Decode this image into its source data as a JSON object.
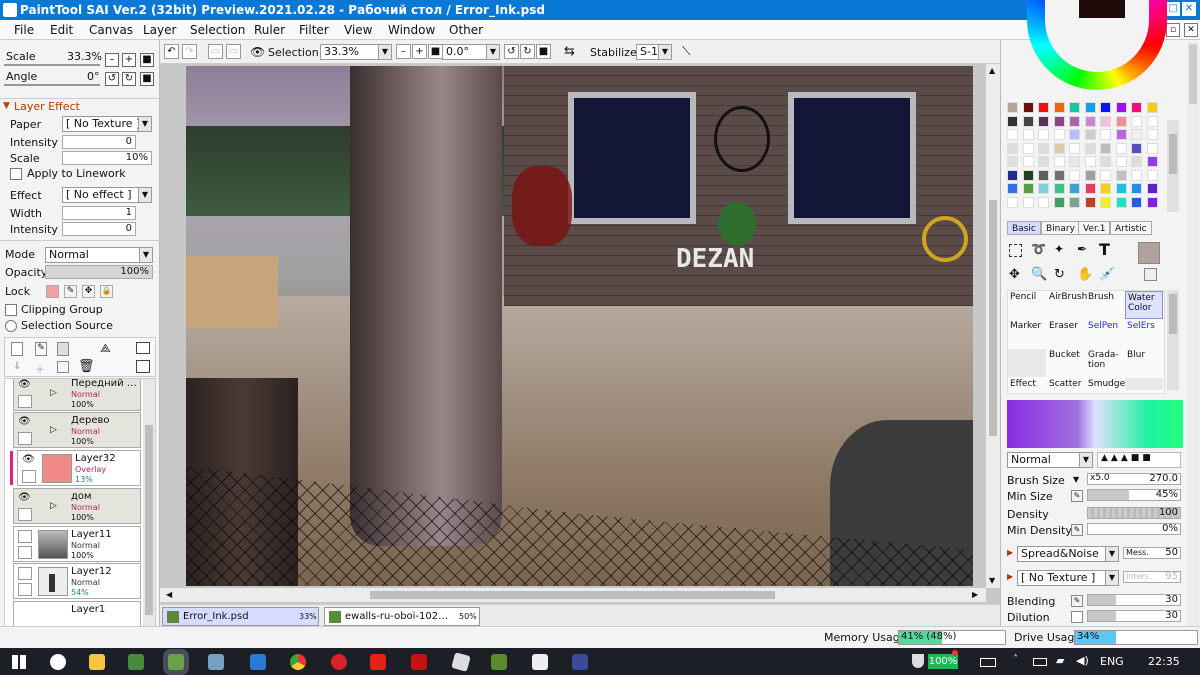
{
  "app": {
    "title": "PaintTool SAI Ver.2 (32bit) Preview.2021.02.28 - Рабочий стол / Error_Ink.psd",
    "minimize": "–",
    "maximize": "□",
    "close": "✕"
  },
  "menu": [
    "File",
    "Edit",
    "Canvas",
    "Layer",
    "Selection",
    "Ruler",
    "Filter",
    "View",
    "Window",
    "Other"
  ],
  "toolbar": {
    "selection_label": "Selection",
    "zoom": "33.3%",
    "angle": "0.0°",
    "stabilizer_label": "Stabilizer",
    "stabilizer_value": "S-1"
  },
  "navigator": {
    "scale_label": "Scale",
    "scale_value": "33.3%",
    "angle_label": "Angle",
    "angle_value": "0°"
  },
  "layer_effect": {
    "header": "Layer Effect",
    "paper_label": "Paper",
    "paper_value": "[ No Texture ]",
    "intensity_label": "Intensity",
    "intensity_value": "0",
    "scale_label": "Scale",
    "scale_value": "10%",
    "apply_label": "Apply to Linework",
    "effect_label": "Effect",
    "effect_value": "[ No effect ]",
    "width_label": "Width",
    "width_value": "1",
    "intensity2_label": "Intensity",
    "intensity2_value": "0"
  },
  "layer_props": {
    "mode_label": "Mode",
    "mode_value": "Normal",
    "opacity_label": "Opacity",
    "opacity_value": "100%",
    "lock_label": "Lock",
    "clipping_label": "Clipping Group",
    "selection_source_label": "Selection Source"
  },
  "layers": [
    {
      "name": "Передний …",
      "mode": "Normal",
      "opacity": "100%",
      "folder": true
    },
    {
      "name": "Дерево",
      "mode": "Normal",
      "opacity": "100%",
      "folder": true
    },
    {
      "name": "Layer32",
      "mode": "Overlay",
      "opacity": "13%",
      "folder": false,
      "thumb": "#f08a86"
    },
    {
      "name": "дом",
      "mode": "Normal",
      "opacity": "100%",
      "folder": true
    },
    {
      "name": "Layer11",
      "mode": "Normal",
      "opacity": "100%",
      "folder": false,
      "thumb": "#777"
    },
    {
      "name": "Layer12",
      "mode": "Normal",
      "opacity": "54%",
      "folder": false,
      "thumb": "#ddd"
    },
    {
      "name": "Layer1",
      "mode": "",
      "opacity": "",
      "folder": false,
      "thumb": "#ddd"
    }
  ],
  "swatches": [
    "#b5a59a",
    "#6b1010",
    "#f01010",
    "#f06410",
    "#10c8a0",
    "#10a0f0",
    "#1010f0",
    "#a010f0",
    "#f01080",
    "#f0d010",
    "#333",
    "#444",
    "#553355",
    "#884488",
    "#aa66aa",
    "#cc88cc",
    "#eec0e0",
    "#ee9090",
    "#fff",
    "#fff",
    "#fff",
    "#fff",
    "#fff",
    "#fff",
    "#bbf",
    "#ccc",
    "#fff",
    "#b6d",
    "#f0f0f0",
    "#fff",
    "#ddd",
    "#fff",
    "#ddd",
    "#dca",
    "#fff",
    "#ddd",
    "#bbb",
    "#fff",
    "#5050c0",
    "#fff",
    "#e0e0e0",
    "#fff",
    "#ddd",
    "#fff",
    "#e8e8e8",
    "#fff",
    "#ddd",
    "#fff",
    "#ddd",
    "#9040e0",
    "#203090",
    "#204020",
    "#606060",
    "#707070",
    "#fff",
    "#a0a0a0",
    "#fff",
    "#c0c0c0",
    "#fff",
    "#fff",
    "#3070e0",
    "#50a040",
    "#80d0e0",
    "#40c090",
    "#40a0d0",
    "#e04060",
    "#f0d020",
    "#20c0e0",
    "#2090e0",
    "#6020c0",
    "#fff",
    "#fff",
    "#fff",
    "#40a060",
    "#80a090",
    "#c04030",
    "#f0f020",
    "#20e0c0",
    "#2060e0",
    "#8020e0"
  ],
  "tool_tabs": [
    "Basic",
    "Binary",
    "Ver.1",
    "Artistic"
  ],
  "brush_tools": [
    [
      "Pencil",
      "AirBrush",
      "Brush",
      "Water Color"
    ],
    [
      "Marker",
      "Eraser",
      "SelPen",
      "SelErs"
    ],
    [
      "",
      "Bucket",
      "Grada-tion",
      "Blur"
    ],
    [
      "Effect",
      "Scatter",
      "Smudge",
      ""
    ]
  ],
  "brush": {
    "mode": "Normal",
    "size_label": "Brush Size",
    "size_mult": "x5.0",
    "size_value": "270.0",
    "min_size_label": "Min Size",
    "min_size_value": "45%",
    "density_label": "Density",
    "density_value": "100",
    "min_density_label": "Min Density",
    "min_density_value": "0%",
    "spread_label": "Spread&Noise",
    "mess_label": "Mess.",
    "mess_value": "50",
    "texture_label": "[ No Texture ]",
    "inters_label": "Inters.",
    "inters_value": "95",
    "blending_label": "Blending",
    "blending_value": "30",
    "dilution_label": "Dilution",
    "dilution_value": "30"
  },
  "file_tabs": [
    {
      "name": "Error_Ink.psd",
      "zoom": "33%"
    },
    {
      "name": "ewalls-ru-oboi-102…",
      "zoom": "50%"
    }
  ],
  "status": {
    "memory_label": "Memory Usage",
    "memory_value": "41% (48%)",
    "memory_fraction": 0.41,
    "drive_label": "Drive Usage",
    "drive_value": "34%",
    "drive_fraction": 0.34
  },
  "taskbar": {
    "battery": "100%",
    "lang": "ENG",
    "time": "22:35"
  },
  "graffiti": "DEZAN"
}
